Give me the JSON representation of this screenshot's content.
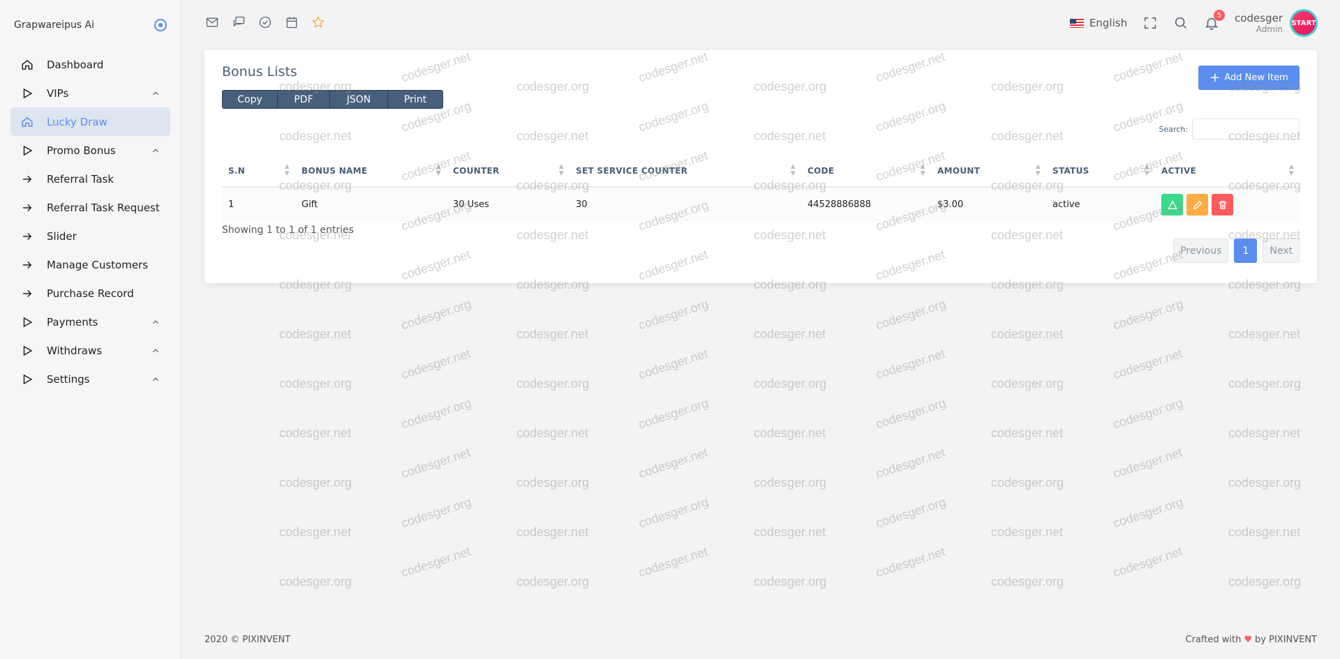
{
  "sidebar": {
    "brand": "Grapwareipus Ai",
    "items": [
      {
        "label": "Dashboard",
        "icon": "home-icon",
        "has_children": false,
        "active": false
      },
      {
        "label": "VIPs",
        "icon": "play-icon",
        "has_children": true,
        "active": false
      },
      {
        "label": "Lucky Draw",
        "icon": "home-icon",
        "has_children": false,
        "active": true
      },
      {
        "label": "Promo Bonus",
        "icon": "play-icon",
        "has_children": true,
        "active": false
      },
      {
        "label": "Referral Task",
        "icon": "arrow-right-icon",
        "has_children": false,
        "active": false
      },
      {
        "label": "Referral Task Request",
        "icon": "arrow-right-icon",
        "has_children": false,
        "active": false
      },
      {
        "label": "Slider",
        "icon": "arrow-right-icon",
        "has_children": false,
        "active": false
      },
      {
        "label": "Manage Customers",
        "icon": "arrow-right-icon",
        "has_children": false,
        "active": false
      },
      {
        "label": "Purchase Record",
        "icon": "arrow-right-icon",
        "has_children": false,
        "active": false
      },
      {
        "label": "Payments",
        "icon": "play-icon",
        "has_children": true,
        "active": false
      },
      {
        "label": "Withdraws",
        "icon": "play-icon",
        "has_children": true,
        "active": false
      },
      {
        "label": "Settings",
        "icon": "play-icon",
        "has_children": true,
        "active": false
      }
    ]
  },
  "topbar": {
    "language": "English",
    "notification_count": "5",
    "user_name": "codesger",
    "user_role": "Admin",
    "avatar_text": "START"
  },
  "card": {
    "title": "Bonus Lists",
    "export_buttons": [
      "Copy",
      "PDF",
      "JSON",
      "Print"
    ],
    "add_button": "Add New Item",
    "search_label": "Search:",
    "columns": [
      "S.N",
      "BONUS NAME",
      "COUNTER",
      "SET SERVICE COUNTER",
      "CODE",
      "AMOUNT",
      "STATUS",
      "ACTIVE"
    ],
    "rows": [
      {
        "sn": "1",
        "bonus_name": "Gift",
        "counter": "30 Uses",
        "set_service_counter": "30",
        "code": "44528886888",
        "amount": "$3.00",
        "status": "active"
      }
    ],
    "info": "Showing 1 to 1 of 1 entries",
    "pager": {
      "previous": "Previous",
      "current": "1",
      "next": "Next"
    }
  },
  "watermark": [
    "codesger.net",
    "codesger.org"
  ],
  "footer": {
    "left": "2020 © PIXINVENT",
    "right_prefix": "Crafted with",
    "right_suffix": "by PIXINVENT"
  },
  "colors": {
    "primary": "#5a8dee",
    "success": "#39da8a",
    "warning": "#fdac41",
    "danger": "#ff5b5c",
    "heading": "#475f7b"
  }
}
